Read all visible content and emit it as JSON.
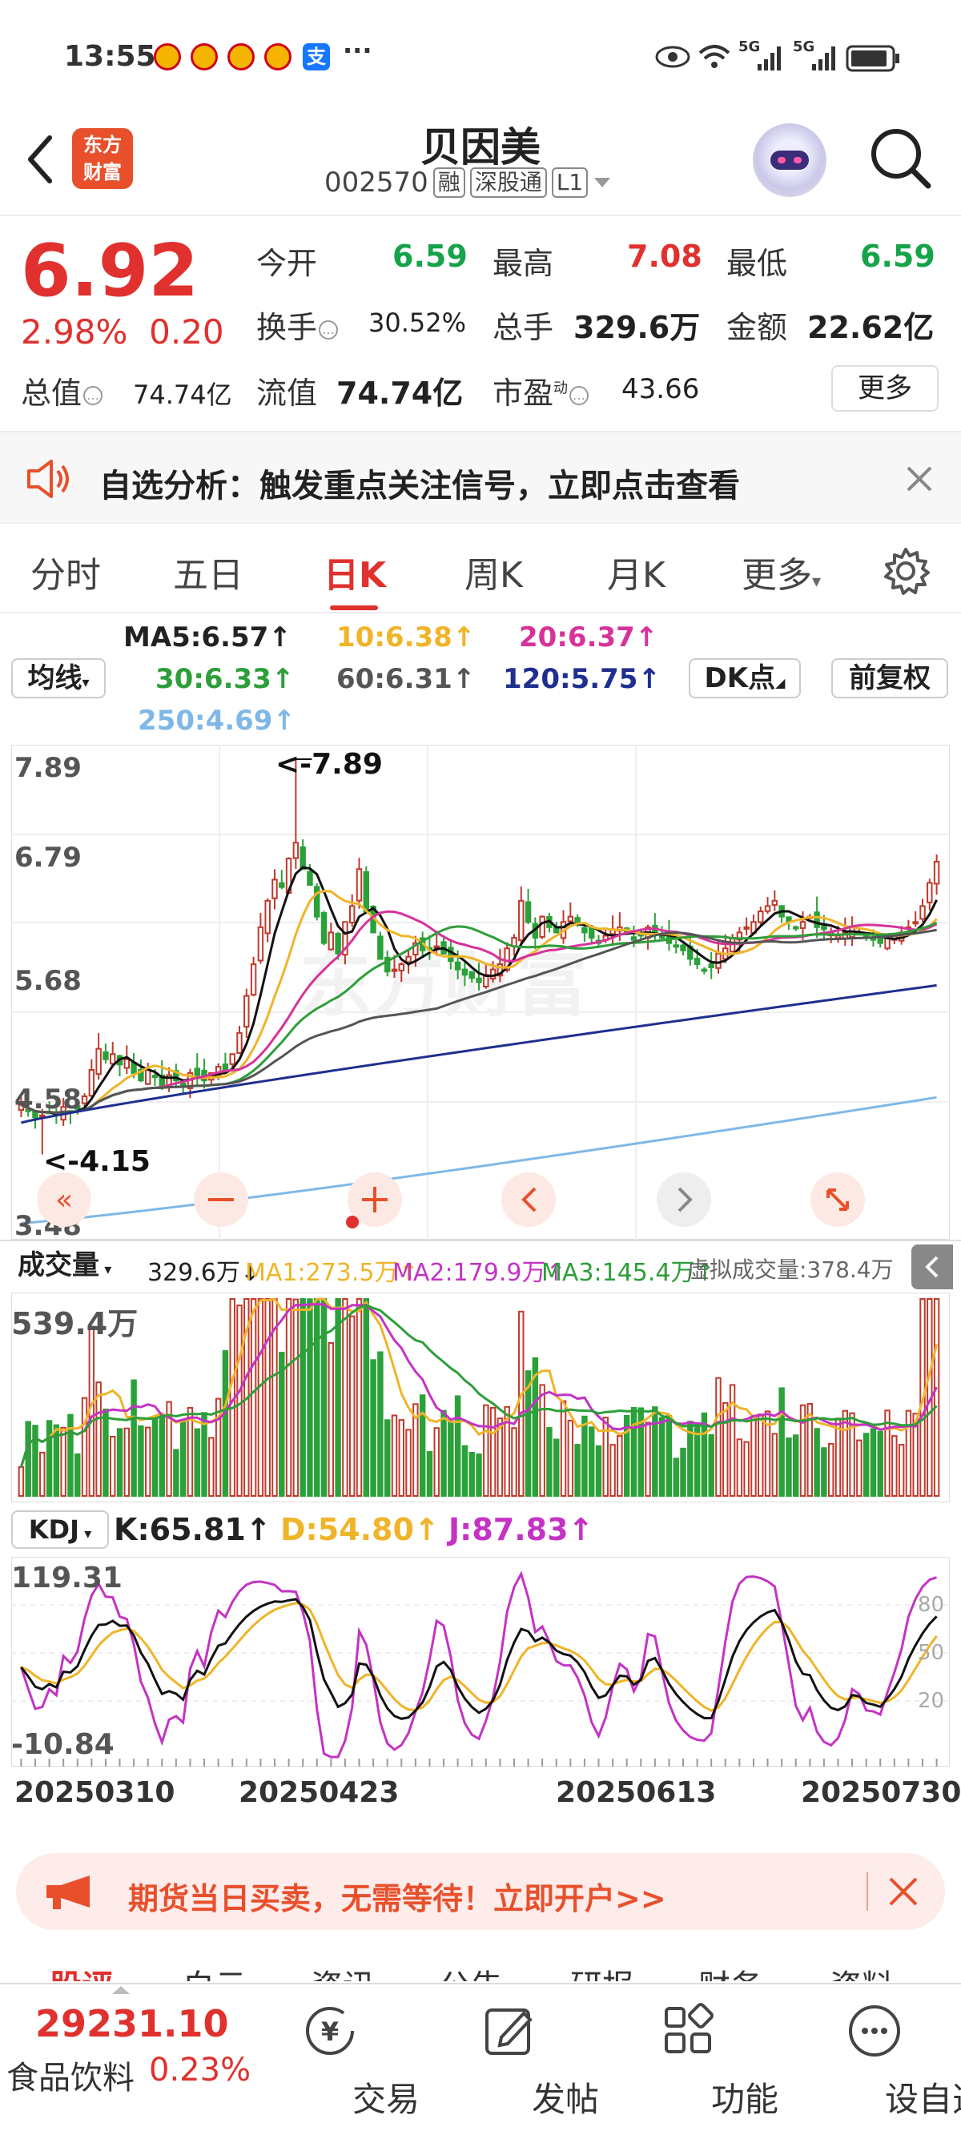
{
  "status_bar": {
    "time": "13:55",
    "signal1": "5G",
    "signal2": "5G",
    "more": "···"
  },
  "header": {
    "title": "贝因美",
    "code": "002570",
    "tags": [
      "融",
      "深股通",
      "L1"
    ],
    "logo_text": "东方财富"
  },
  "quote": {
    "price": "6.92",
    "change_pct": "2.98%",
    "change_abs": "0.20",
    "stats": [
      {
        "label": "今开",
        "value": "6.59"
      },
      {
        "label": "最高",
        "value": "7.08"
      },
      {
        "label": "最低",
        "value": "6.59"
      },
      {
        "label": "换手",
        "value": "30.52%"
      },
      {
        "label": "总手",
        "value": "329.6万"
      },
      {
        "label": "金额",
        "value": "22.62亿"
      },
      {
        "label": "总值",
        "value": "74.74亿"
      },
      {
        "label": "流值",
        "value": "74.74亿"
      },
      {
        "label": "市盈",
        "superscript": "动",
        "value": "43.66"
      }
    ],
    "more_button": "更多"
  },
  "alert": {
    "text": "自选分析：触发重点关注信号，立即点击查看"
  },
  "tabs": [
    "分时",
    "五日",
    "日K",
    "周K",
    "月K",
    "更多"
  ],
  "active_tab": "日K",
  "ma_legend": {
    "ma_button": "均线",
    "items": [
      {
        "text": "MA5:6.57",
        "color": "#222222"
      },
      {
        "text": "10:6.38",
        "color": "#f0b429"
      },
      {
        "text": "20:6.37",
        "color": "#d6339a"
      },
      {
        "text": "30:6.33",
        "color": "#2e9e3a"
      },
      {
        "text": "60:6.31",
        "color": "#555555"
      },
      {
        "text": "120:5.75",
        "color": "#1f2f8f"
      },
      {
        "text": "250:4.69",
        "color": "#7fb8e6"
      }
    ],
    "dk_button": "DK点",
    "adjust_button": "前复权"
  },
  "price_axis": [
    "7.89",
    "6.79",
    "5.68",
    "4.58",
    "3.48"
  ],
  "annotations": {
    "high": "<-7.89",
    "low": "<-4.15"
  },
  "watermark": "东方财富",
  "volume": {
    "selector": "成交量",
    "current": "329.6万",
    "ma1": "MA1:273.5万",
    "ma2": "MA2:179.9万",
    "ma3": "MA3:145.4万",
    "virtual": "虚拟成交量:378.4万",
    "axis_max": "539.4万",
    "colors": {
      "ma1": "#f0b429",
      "ma2": "#c433c4",
      "ma3": "#2e9e3a"
    }
  },
  "kdj": {
    "selector": "KDJ",
    "k": "K:65.81",
    "d": "D:54.80",
    "j": "J:87.83",
    "axis_top": "119.31",
    "axis_bottom": "-10.84",
    "levels": [
      "80",
      "50",
      "20"
    ]
  },
  "dates": [
    "20250310",
    "20250423",
    "20250613",
    "20250730"
  ],
  "promo": {
    "text": "期货当日买卖，无需等待！立即开户>>"
  },
  "bottom_nav": {
    "index_value": "29231.10",
    "index_name": "食品饮料",
    "index_change": "0.23%",
    "items": [
      "交易",
      "发帖",
      "功能",
      "设自选"
    ]
  },
  "hidden_tabs_row": [
    "股评",
    "白云",
    "资讯",
    "公告",
    "研报",
    "财务",
    "资料"
  ],
  "chart_data": {
    "type": "candlestick",
    "title": "贝因美 日K",
    "xlabel": "",
    "ylabel": "",
    "ylim": [
      3.48,
      7.89
    ],
    "x_ticks": [
      "20250310",
      "20250423",
      "20250613",
      "20250730"
    ],
    "closes": [
      4.62,
      4.56,
      4.5,
      4.52,
      4.55,
      4.52,
      4.6,
      4.55,
      4.58,
      4.7,
      4.95,
      5.15,
      5.05,
      5.1,
      5.0,
      5.05,
      4.92,
      4.85,
      4.95,
      4.88,
      4.8,
      4.9,
      4.85,
      4.82,
      4.92,
      4.9,
      4.85,
      4.92,
      4.98,
      4.95,
      5.1,
      5.3,
      5.65,
      5.95,
      6.3,
      6.55,
      6.75,
      6.68,
      6.95,
      7.1,
      6.85,
      6.7,
      6.4,
      6.15,
      6.25,
      6.05,
      6.35,
      6.5,
      6.85,
      6.45,
      6.25,
      6.0,
      5.88,
      5.9,
      5.95,
      6.02,
      6.15,
      6.08,
      6.1,
      6.12,
      6.05,
      5.98,
      5.9,
      5.85,
      5.82,
      5.78,
      5.85,
      5.9,
      5.95,
      6.1,
      6.2,
      6.55,
      6.35,
      6.2,
      6.4,
      6.3,
      6.25,
      6.35,
      6.4,
      6.35,
      6.25,
      6.2,
      6.15,
      6.22,
      6.28,
      6.3,
      6.25,
      6.18,
      6.22,
      6.3,
      6.25,
      6.2,
      6.15,
      6.12,
      6.08,
      6.0,
      5.95,
      5.9,
      5.92,
      6.05,
      6.1,
      6.2,
      6.25,
      6.3,
      6.35,
      6.45,
      6.5,
      6.55,
      6.4,
      6.35,
      6.3,
      6.35,
      6.4,
      6.3,
      6.28,
      6.25,
      6.22,
      6.25,
      6.3,
      6.25,
      6.2,
      6.18,
      6.15,
      6.2,
      6.22,
      6.25,
      6.3,
      6.35,
      6.5,
      6.72,
      6.92
    ],
    "ma": {
      "ma5": 6.57,
      "ma10": 6.38,
      "ma20": 6.37,
      "ma30": 6.33,
      "ma60": 6.31,
      "ma120": 5.75,
      "ma250": 4.69
    }
  }
}
